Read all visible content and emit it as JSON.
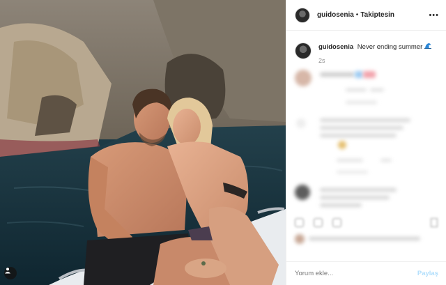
{
  "header": {
    "username": "guidosenia",
    "separator": "•",
    "follow_label": "Takiptesin",
    "more_icon": "•••"
  },
  "caption": {
    "username": "guidosenia",
    "text": "Never ending summer",
    "emoji_icon": "wave-icon",
    "time": "2s"
  },
  "comment_box": {
    "placeholder": "Yorum ekle...",
    "post_label": "Paylaş"
  },
  "colors": {
    "accent_blue": "#b2dffc",
    "text_primary": "#262626",
    "text_secondary": "#8e8e8e"
  }
}
